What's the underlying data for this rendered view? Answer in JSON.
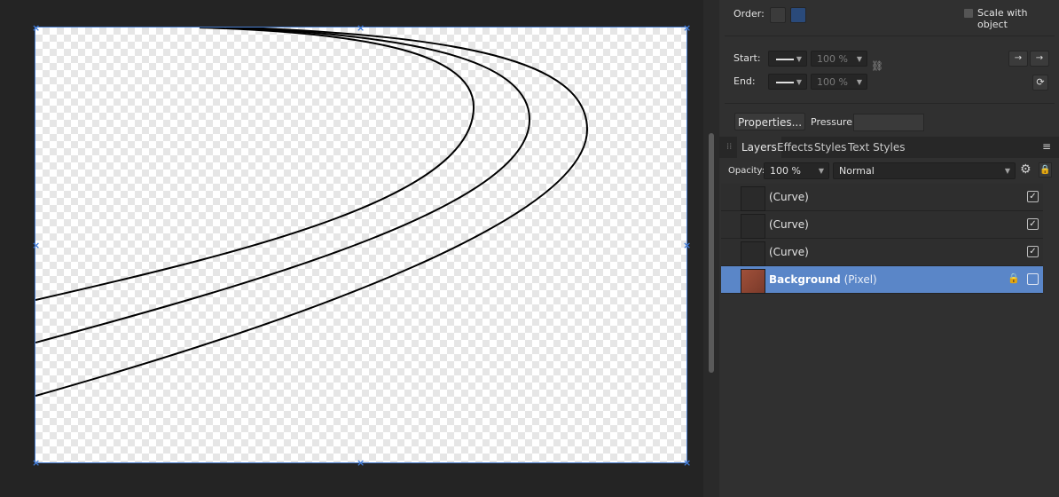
{
  "context": {
    "order_label": "Order:",
    "scale_with_object": "Scale with object"
  },
  "line": {
    "start_label": "Start:",
    "end_label": "End:",
    "start_scale": "100 %",
    "end_scale": "100 %"
  },
  "properties_button": "Properties...",
  "pressure_label": "Pressure:",
  "tabs": [
    "Layers",
    "Effects",
    "Styles",
    "Text Styles"
  ],
  "opacity_label": "Opacity:",
  "opacity_value": "100 %",
  "blend_mode": "Normal",
  "layers": [
    {
      "name": "(Curve)"
    },
    {
      "name": "(Curve)"
    },
    {
      "name": "(Curve)"
    },
    {
      "name": "Background",
      "type": "(Pixel)"
    }
  ],
  "colors": {
    "selection": "#5a86c8",
    "accent": "#3f79d6"
  }
}
